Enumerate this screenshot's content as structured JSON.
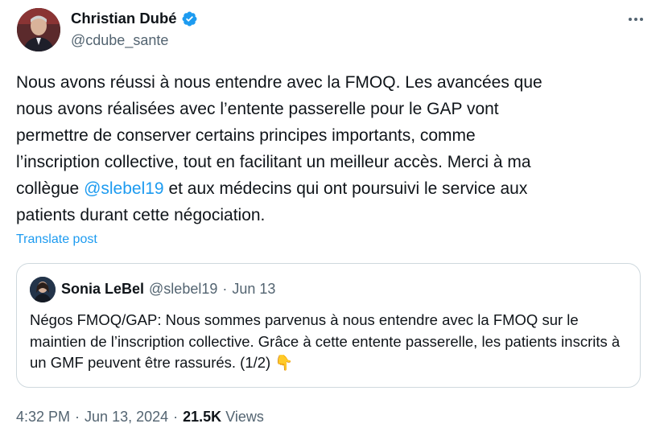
{
  "author": {
    "display_name": "Christian Dubé",
    "handle": "@cdube_sante",
    "verified": true
  },
  "tweet": {
    "text_1": "Nous avons réussi à nous entendre avec la FMOQ. Les avancées que\nnous avons réalisées avec l’entente passerelle pour le GAP vont\npermettre de conserver certains principes importants, comme\nl’inscription collective, tout en facilitant un meilleur accès. Merci à ma\ncollègue ",
    "mention": "@slebel19",
    "text_2": " et aux médecins qui ont poursuivi le service aux\npatients durant cette négociation.",
    "translate_label": "Translate post"
  },
  "quoted": {
    "display_name": "Sonia LeBel",
    "handle": "@slebel19",
    "separator": "·",
    "date": "Jun 13",
    "text": "Négos FMOQ/GAP: Nous sommes parvenus à nous entendre avec la FMOQ sur le maintien de l’inscription collective. Grâce à cette entente passerelle, les patients inscrits à un GMF peuvent être rassurés. (1/2) 👇"
  },
  "footer": {
    "time": "4:32 PM",
    "sep1": "·",
    "date": "Jun 13, 2024",
    "sep2": "·",
    "views_count": "21.5K",
    "views_label": "Views"
  },
  "icons": {
    "verified": "verified-badge-icon",
    "more": "more-options-icon"
  },
  "colors": {
    "link": "#1d9bf0",
    "muted": "#536471",
    "text": "#0f1419",
    "border": "#cfd9de"
  }
}
